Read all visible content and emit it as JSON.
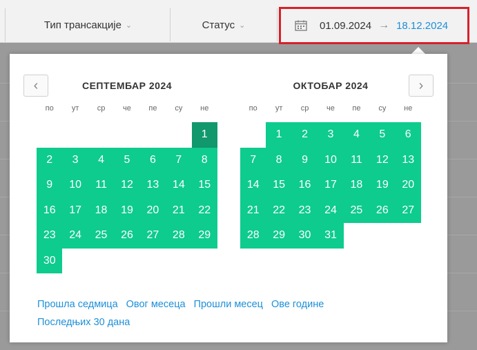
{
  "filters": {
    "transaction_type": "Тип трансакције",
    "status": "Статус"
  },
  "date_range": {
    "start": "01.09.2024",
    "arrow": "→",
    "end": "18.12.2024"
  },
  "calendar": {
    "weekday_labels": [
      "по",
      "ут",
      "ср",
      "че",
      "пе",
      "су",
      "не"
    ],
    "months": [
      {
        "title": "СЕПТЕМБАР 2024",
        "leading_blanks": 6,
        "days": [
          "1",
          "2",
          "3",
          "4",
          "5",
          "6",
          "7",
          "8",
          "9",
          "10",
          "11",
          "12",
          "13",
          "14",
          "15",
          "16",
          "17",
          "18",
          "19",
          "20",
          "21",
          "22",
          "23",
          "24",
          "25",
          "26",
          "27",
          "28",
          "29",
          "30"
        ],
        "selected_start": "1"
      },
      {
        "title": "ОКТОБАР 2024",
        "leading_blanks": 1,
        "days": [
          "1",
          "2",
          "3",
          "4",
          "5",
          "6",
          "7",
          "8",
          "9",
          "10",
          "11",
          "12",
          "13",
          "14",
          "15",
          "16",
          "17",
          "18",
          "19",
          "20",
          "21",
          "22",
          "23",
          "24",
          "25",
          "26",
          "27",
          "28",
          "29",
          "30",
          "31"
        ],
        "selected_start": ""
      }
    ]
  },
  "presets": [
    "Прошла седмица",
    "Овог месеца",
    "Прошли месец",
    "Ове године",
    "Последњих 30 дана"
  ],
  "colors": {
    "range_fill": "#0ecb8e",
    "range_start": "#11986c",
    "link": "#1d8fd8",
    "highlight_border": "#d7202a"
  }
}
